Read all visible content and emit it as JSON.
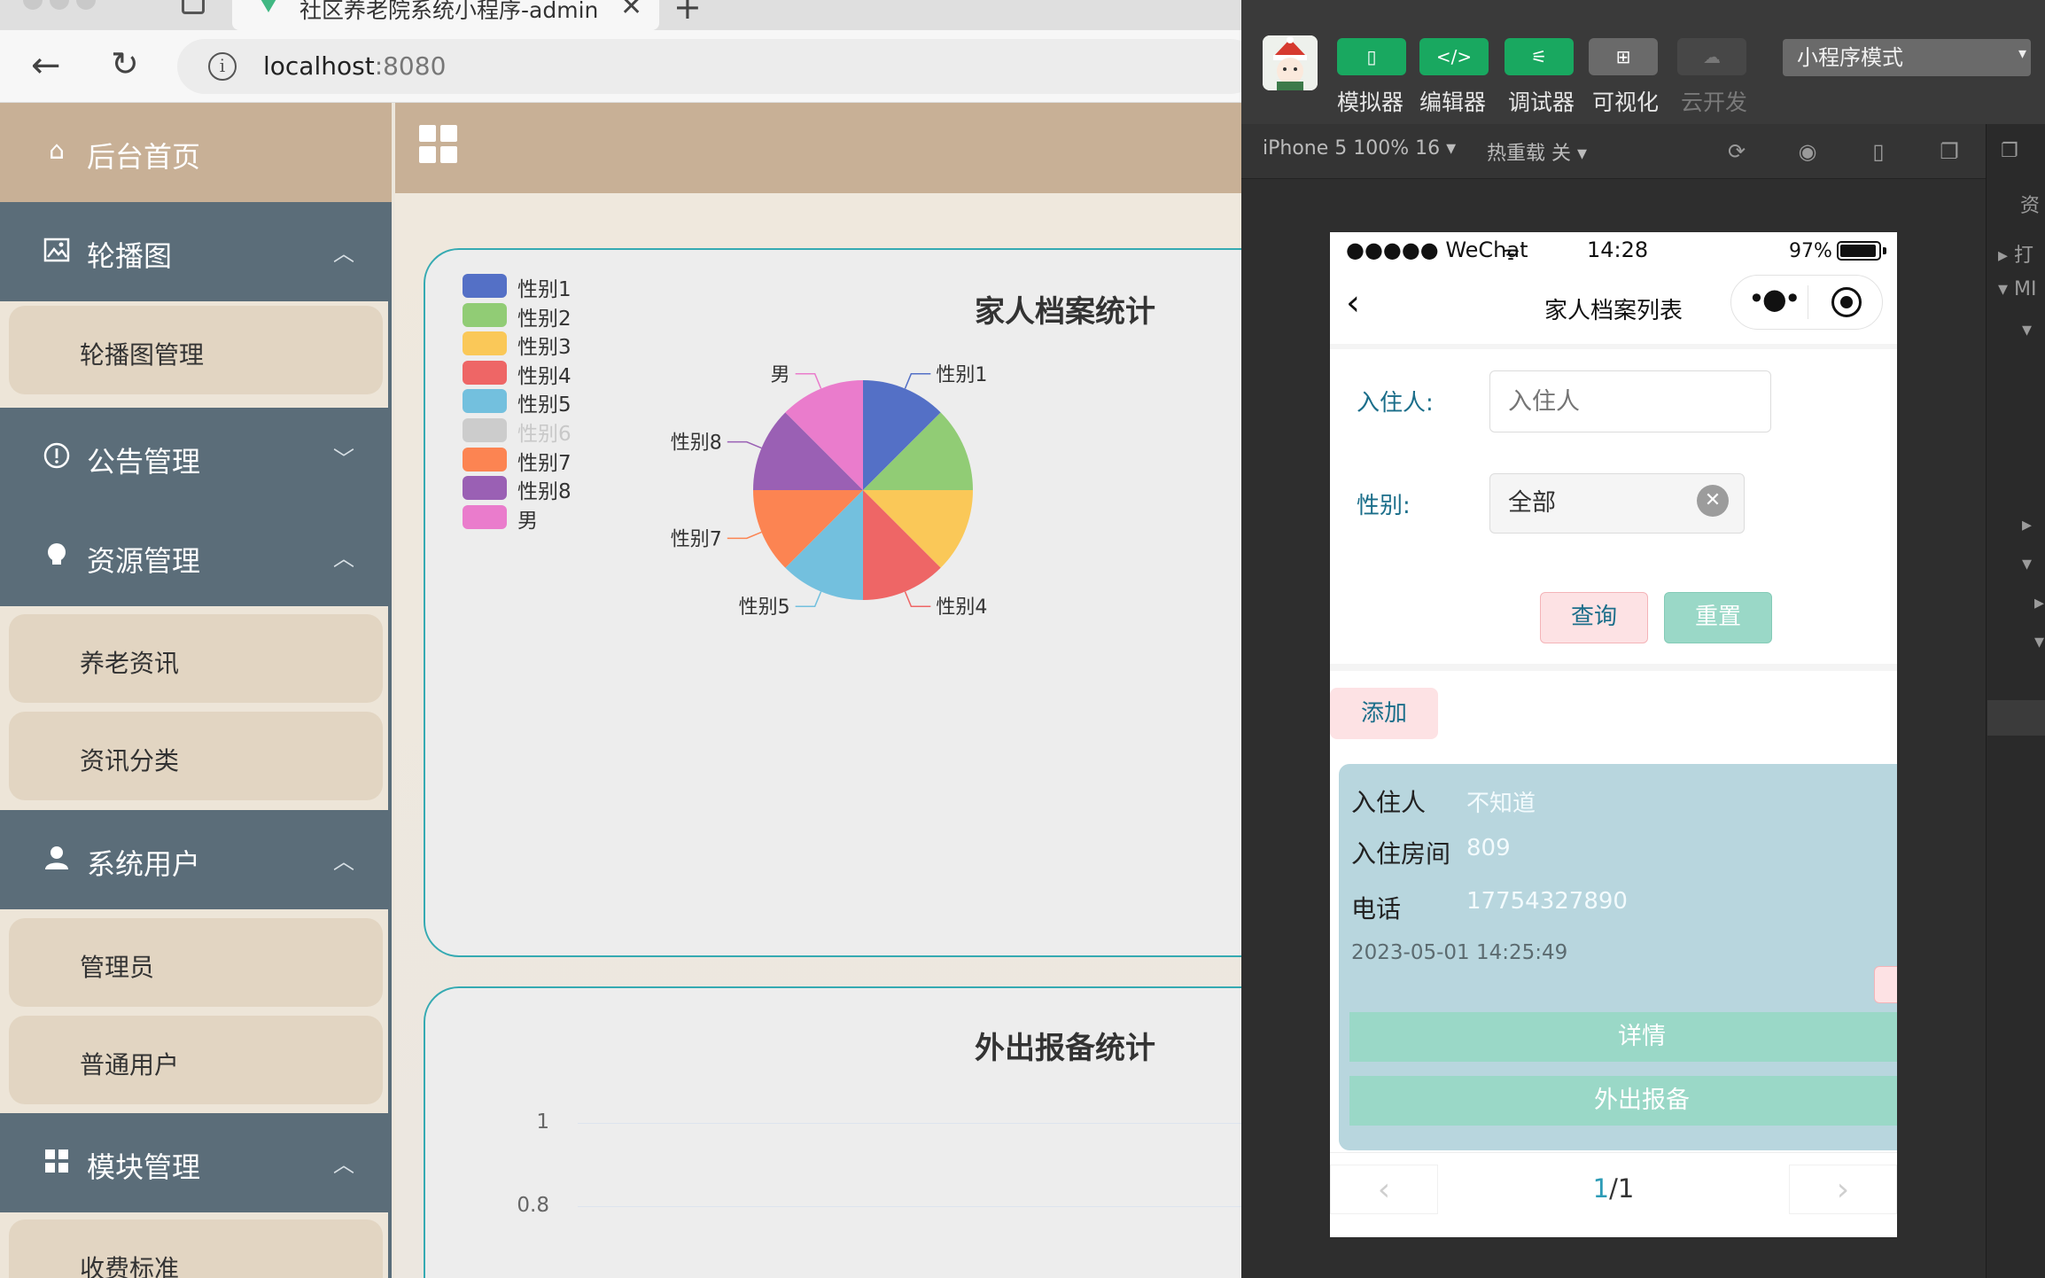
{
  "browser": {
    "tab_title": "社区养老院系统小程序-admin",
    "url_host": "localhost",
    "url_port": ":8080"
  },
  "sidebar": {
    "home": "后台首页",
    "groups": [
      {
        "label": "轮播图",
        "icon": "image-icon",
        "expanded": true,
        "items": [
          "轮播图管理"
        ]
      },
      {
        "label": "公告管理",
        "icon": "alert-circle-icon",
        "expanded": false,
        "items": []
      },
      {
        "label": "资源管理",
        "icon": "lightbulb-icon",
        "expanded": true,
        "items": [
          "养老资讯",
          "资讯分类"
        ]
      },
      {
        "label": "系统用户",
        "icon": "user-icon",
        "expanded": true,
        "items": [
          "管理员",
          "普通用户"
        ]
      },
      {
        "label": "模块管理",
        "icon": "grid-icon",
        "expanded": true,
        "items": [
          "收费标准"
        ]
      }
    ]
  },
  "dashboard": {
    "chart1_title": "家人档案统计",
    "chart2_title": "外出报备统计"
  },
  "chart_data": [
    {
      "type": "pie",
      "title": "家人档案统计",
      "legend_position": "top-left",
      "categories": [
        "性别1",
        "性别2",
        "性别3",
        "性别4",
        "性别5",
        "性别6",
        "性别7",
        "性别8",
        "男"
      ],
      "values": [
        1,
        1,
        1,
        1,
        1,
        0,
        1,
        1,
        1
      ],
      "hidden": [
        "性别6"
      ],
      "colors": [
        "#5470c6",
        "#91cc75",
        "#fac858",
        "#ee6666",
        "#73c0de",
        "#cccccc",
        "#fc8452",
        "#9a60b4",
        "#ea7ccc"
      ],
      "slice_labels_visible": [
        "男",
        "性别1",
        "性别8",
        "性别7",
        "性别5",
        "性别4"
      ]
    },
    {
      "type": "bar",
      "title": "外出报备统计",
      "y_ticks": [
        "1",
        "0.8"
      ],
      "ylim": [
        0,
        1
      ]
    }
  ],
  "devtools": {
    "buttons": [
      {
        "label": "模拟器",
        "glyph": "▯",
        "state": "active"
      },
      {
        "label": "编辑器",
        "glyph": "</>",
        "state": "active"
      },
      {
        "label": "调试器",
        "glyph": "⚟",
        "state": "active"
      },
      {
        "label": "可视化",
        "glyph": "⊞",
        "state": "inactive"
      },
      {
        "label": "云开发",
        "glyph": "☁",
        "state": "disabled"
      }
    ],
    "mode": "小程序模式",
    "device": "iPhone 5 100% 16 ▾",
    "hot_reload": "热重载 关 ▾",
    "right_panel_texts": [
      "资",
      "打",
      "MI"
    ]
  },
  "phone": {
    "status": {
      "carrier": "●●●●● WeChat",
      "time": "14:28",
      "battery": "97%"
    },
    "nav_title": "家人档案列表",
    "form": {
      "resident_label": "入住人:",
      "resident_placeholder": "入住人",
      "gender_label": "性别:",
      "gender_value": "全部"
    },
    "search_button": "查询",
    "reset_button": "重置",
    "add_button": "添加",
    "record": {
      "resident_key": "入住人",
      "resident_val": "不知道",
      "room_key": "入住房间",
      "room_val": "809",
      "phone_key": "电话",
      "phone_val": "17754327890",
      "timestamp": "2023-05-01 14:25:49",
      "detail_button": "详情",
      "outing_button": "外出报备"
    },
    "pager": {
      "current": "1",
      "total": "/1"
    }
  }
}
